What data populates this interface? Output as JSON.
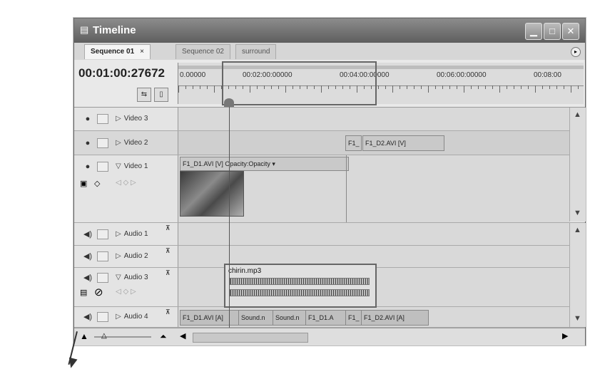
{
  "window": {
    "title": "Timeline"
  },
  "tabs": [
    {
      "label": "Sequence 01",
      "close": "×"
    },
    {
      "label": "Sequence 02"
    },
    {
      "label": "surround"
    }
  ],
  "timecode": "00:01:00:27672",
  "ruler": {
    "labels": [
      "0.00000",
      "00:02:00:00000",
      "00:04:00:00000",
      "00:06:00:00000",
      "00:08:00"
    ]
  },
  "tracks": {
    "video3": {
      "label": "Video 3"
    },
    "video2": {
      "label": "Video 2",
      "clips": [
        "F1_",
        "F1_D2.AVI [V]"
      ]
    },
    "video1": {
      "label": "Video 1",
      "clip": "F1_D1.AVI [V] Opacity:Opacity ▾"
    },
    "audio1": {
      "label": "Audio 1"
    },
    "audio2": {
      "label": "Audio 2"
    },
    "audio3": {
      "label": "Audio 3",
      "clip": "chirin.mp3"
    },
    "audio4": {
      "label": "Audio 4",
      "clips": [
        "F1_D1.AVI [A]",
        "Sound.n",
        "Sound.n",
        "F1_D1.A",
        "F1_",
        "F1_D2.AVI [A]"
      ]
    }
  },
  "icons": [
    "timeline-icon",
    "eye-icon",
    "speaker-icon",
    "expand-triangle-icon",
    "no-entry-icon"
  ]
}
